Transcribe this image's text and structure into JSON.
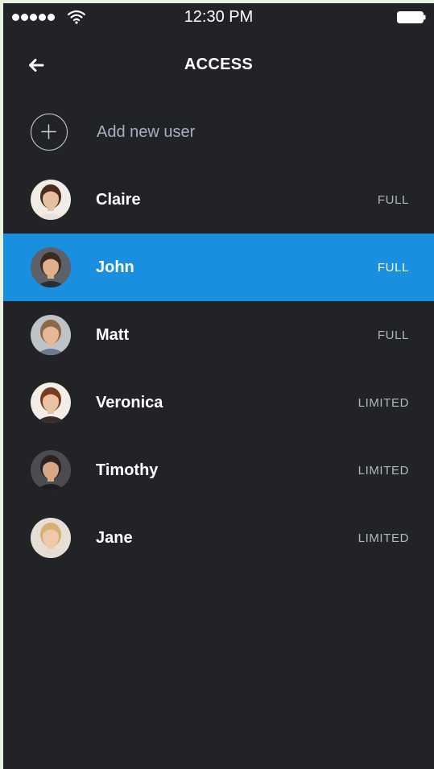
{
  "status_bar": {
    "time": "12:30 PM"
  },
  "header": {
    "title": "ACCESS"
  },
  "add_user": {
    "label": "Add new user"
  },
  "users": [
    {
      "name": "Claire",
      "access": "FULL",
      "selected": false,
      "skin": "#e8bfa0",
      "hair": "#4a2a18",
      "shirt": "#e8e2dc",
      "bg": "#f1ece6"
    },
    {
      "name": "John",
      "access": "FULL",
      "selected": true,
      "skin": "#e0b08c",
      "hair": "#3a2a20",
      "shirt": "#2b2d33",
      "bg": "#5c6068"
    },
    {
      "name": "Matt",
      "access": "FULL",
      "selected": false,
      "skin": "#e6b896",
      "hair": "#8a6a48",
      "shirt": "#6b7a92",
      "bg": "#bfc2c6"
    },
    {
      "name": "Veronica",
      "access": "LIMITED",
      "selected": false,
      "skin": "#ecc2a4",
      "hair": "#7a3c22",
      "shirt": "#3a2a2a",
      "bg": "#f3ede8"
    },
    {
      "name": "Timothy",
      "access": "LIMITED",
      "selected": false,
      "skin": "#d8a886",
      "hair": "#2a2220",
      "shirt": "#1e1f22",
      "bg": "#4a4c50"
    },
    {
      "name": "Jane",
      "access": "LIMITED",
      "selected": false,
      "skin": "#f0c8aa",
      "hair": "#d8b070",
      "shirt": "#e6ddd2",
      "bg": "#e6dfd6"
    }
  ],
  "colors": {
    "background": "#222327",
    "selected_row": "#1a8fe0",
    "muted_text": "#a7b0c2"
  }
}
